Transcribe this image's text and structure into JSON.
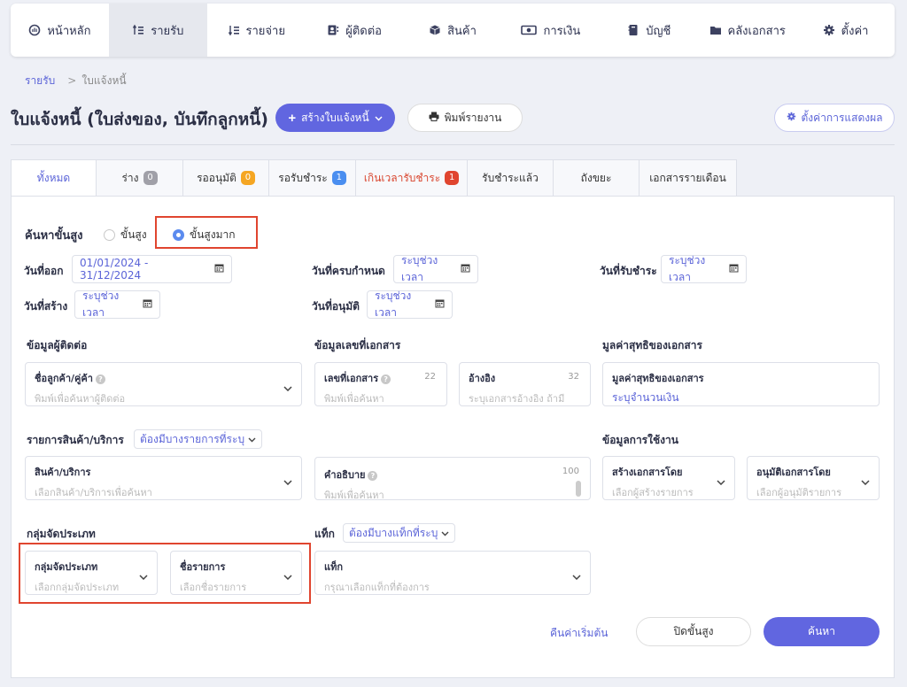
{
  "nav": {
    "items": [
      {
        "label": "หน้าหลัก",
        "icon": "dashboard-icon"
      },
      {
        "label": "รายรับ",
        "icon": "income-icon"
      },
      {
        "label": "รายจ่าย",
        "icon": "expense-icon"
      },
      {
        "label": "ผู้ติดต่อ",
        "icon": "contacts-icon"
      },
      {
        "label": "สินค้า",
        "icon": "product-box-icon"
      },
      {
        "label": "การเงิน",
        "icon": "money-icon"
      },
      {
        "label": "บัญชี",
        "icon": "ledger-icon"
      },
      {
        "label": "คลังเอกสาร",
        "icon": "folder-icon"
      },
      {
        "label": "ตั้งค่า",
        "icon": "gear-icon"
      }
    ]
  },
  "breadcrumb": {
    "root": "รายรับ",
    "current": "ใบแจ้งหนี้"
  },
  "header": {
    "title": "ใบแจ้งหนี้ (ใบส่งของ, บันทึกลูกหนี้)",
    "create_label": "สร้างใบแจ้งหนี้",
    "print_label": "พิมพ์รายงาน",
    "display_settings_label": "ตั้งค่าการแสดงผล"
  },
  "tabs": [
    {
      "label": "ทั้งหมด",
      "badge": ""
    },
    {
      "label": "ร่าง",
      "badge": "0"
    },
    {
      "label": "รออนุมัติ",
      "badge": "0"
    },
    {
      "label": "รอรับชำระ",
      "badge": "1"
    },
    {
      "label": "เกินเวลารับชำระ",
      "badge": "1"
    },
    {
      "label": "รับชำระแล้ว",
      "badge": ""
    },
    {
      "label": "ถังขยะ",
      "badge": ""
    },
    {
      "label": "เอกสารรายเดือน",
      "badge": ""
    }
  ],
  "colors": {
    "accent": "#6166e0",
    "badge_gray": "#a0a0a8",
    "badge_orange": "#f5a623",
    "badge_blue": "#4a8ef0",
    "badge_red": "#e0452f",
    "highlight": "#e0452f"
  },
  "search": {
    "title": "ค้นหาขั้นสูง",
    "mode_advanced": "ขั้นสูง",
    "mode_very_advanced": "ขั้นสูงมาก",
    "issue_date_label": "วันที่ออก",
    "issue_date_value": "01/01/2024 - 31/12/2024",
    "due_date_label": "วันที่ครบกำหนด",
    "due_date_value": "ระบุช่วงเวลา",
    "payment_date_label": "วันที่รับชำระ",
    "payment_date_value": "ระบุช่วงเวลา",
    "created_date_label": "วันที่สร้าง",
    "created_date_value": "ระบุช่วงเวลา",
    "approved_date_label": "วันที่อนุมัติ",
    "approved_date_value": "ระบุช่วงเวลา",
    "contact_section": "ข้อมูลผู้ติดต่อ",
    "contact_label": "ชื่อลูกค้า/คู่ค้า",
    "contact_placeholder": "พิมพ์เพื่อค้นหาผู้ติดต่อ",
    "docnum_section": "ข้อมูลเลขที่เอกสาร",
    "docnum_label": "เลขที่เอกสาร",
    "docnum_count": "22",
    "docnum_placeholder": "พิมพ์เพื่อค้นหา",
    "reference_label": "อ้างอิง",
    "reference_count": "32",
    "reference_placeholder": "ระบุเอกสารอ้างอิง ถ้ามี",
    "net_section": "มูลค่าสุทธิของเอกสาร",
    "net_label": "มูลค่าสุทธิของเอกสาร",
    "net_value": "ระบุจำนวนเงิน",
    "products_section": "รายการสินค้า/บริการ",
    "products_filter": "ต้องมีบางรายการที่ระบุ",
    "product_label": "สินค้า/บริการ",
    "product_placeholder": "เลือกสินค้า/บริการเพื่อค้นหา",
    "description_label": "คำอธิบาย",
    "description_count": "100",
    "description_placeholder": "พิมพ์เพื่อค้นหา",
    "usage_section": "ข้อมูลการใช้งาน",
    "created_by_label": "สร้างเอกสารโดย",
    "created_by_placeholder": "เลือกผู้สร้างรายการ",
    "approved_by_label": "อนุมัติเอกสารโดย",
    "approved_by_placeholder": "เลือกผู้อนุมัติรายการ",
    "category_section": "กลุ่มจัดประเภท",
    "category_label": "กลุ่มจัดประเภท",
    "category_placeholder": "เลือกกลุ่มจัดประเภท",
    "category_item_label": "ชื่อรายการ",
    "category_item_placeholder": "เลือกชื่อรายการ",
    "tag_section": "แท็ก",
    "tag_filter": "ต้องมีบางแท็กที่ระบุ",
    "tag_label": "แท็ก",
    "tag_placeholder": "กรุณาเลือกแท็กที่ต้องการ",
    "reset_label": "คืนค่าเริ่มต้น",
    "close_label": "ปิดขั้นสูง",
    "search_label": "ค้นหา"
  }
}
